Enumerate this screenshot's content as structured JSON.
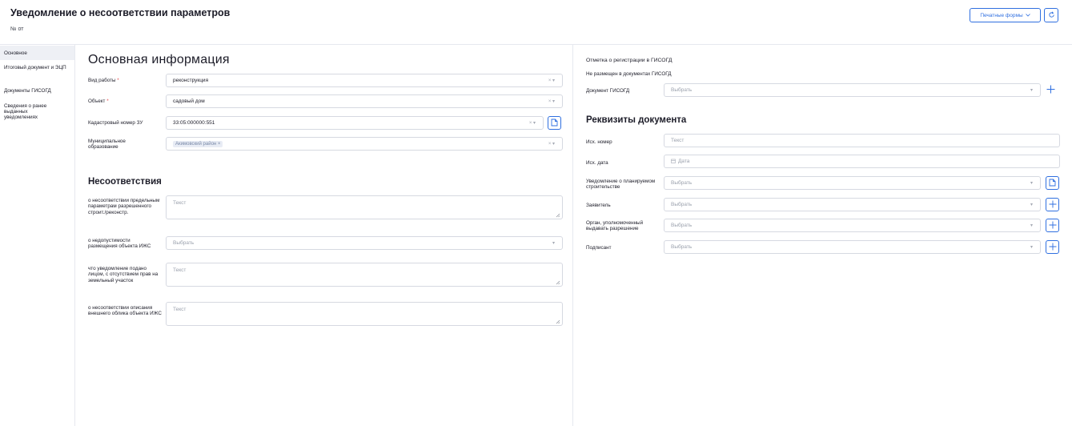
{
  "header": {
    "title": "Уведомление о несоответствии параметров",
    "number": "№ от",
    "print_label": "Печатные формы"
  },
  "sidebar": {
    "items": [
      {
        "label": "Основное"
      },
      {
        "label": "Итоговый документ и ЭЦП"
      },
      {
        "label": "Документы ГИСОГД"
      },
      {
        "label": "Сведения о ранее выданных уведомлениях"
      }
    ]
  },
  "main": {
    "heading": "Основная информация",
    "work_type": {
      "label": "Вид работы",
      "value": "реконструкция"
    },
    "object": {
      "label": "Объект",
      "value": "садовый дом"
    },
    "cadastral": {
      "label": "Кадастровый номер ЗУ",
      "value": "33:05:000000:551"
    },
    "municipal": {
      "label": "Муниципальное образование",
      "tag": "Акимовский район"
    },
    "mismatch_heading": "Несоответствия",
    "mismatch_params": {
      "label": "о несоответствии предельным параметрам разрешенного строит./реконстр.",
      "placeholder": "Текст"
    },
    "inadmissible": {
      "label": "о недопустимости размещения объекта ИЖС",
      "placeholder": "Выбрать"
    },
    "no_rights": {
      "label": "что уведомление подано лицом, с отсутствием прав на земельный участок",
      "placeholder": "Текст"
    },
    "appearance": {
      "label": "о несоответствии описания внешнего облика объекта ИЖС",
      "placeholder": "Текст"
    }
  },
  "right": {
    "reg_title": "Отметка о регистрации в ГИСОГД",
    "reg_status": "Не размещен в документах ГИСОГД",
    "gisogd_doc": {
      "label": "Документ ГИСОГД",
      "placeholder": "Выбрать"
    },
    "requisites_heading": "Реквизиты документа",
    "out_number": {
      "label": "Исх. номер",
      "placeholder": "Текст"
    },
    "out_date": {
      "label": "Исх. дата",
      "placeholder": "Дата"
    },
    "planned_notice": {
      "label": "Уведомление о планируемом строительстве",
      "placeholder": "Выбрать"
    },
    "applicant": {
      "label": "Заявитель",
      "placeholder": "Выбрать"
    },
    "authority": {
      "label": "Орган, уполномоченный выдавать разрешение",
      "placeholder": "Выбрать"
    },
    "signer": {
      "label": "Подписант",
      "placeholder": "Выбрать"
    }
  },
  "colors": {
    "accent": "#2f6fe0",
    "required": "#e5484d",
    "border": "#d6d9e1"
  }
}
